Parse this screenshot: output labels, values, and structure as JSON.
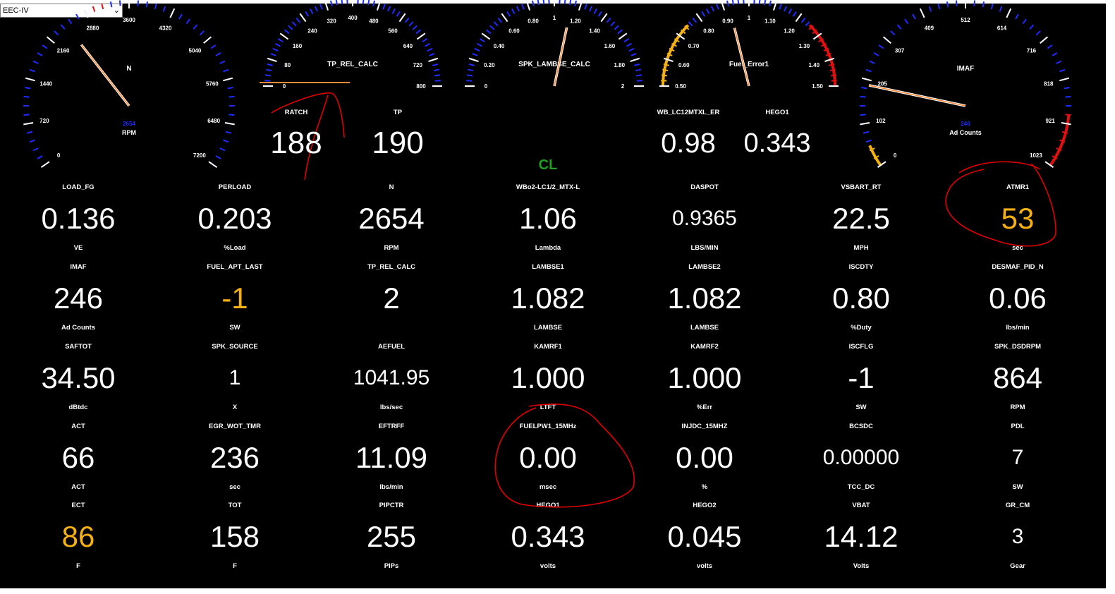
{
  "window": {
    "select_value": "EEC-IV"
  },
  "gauges": [
    {
      "id": "rpm",
      "title": "N",
      "unit": "RPM",
      "value": "2654",
      "ticks": [
        "0",
        "720",
        "1440",
        "2160",
        "2880",
        "3600",
        "4320",
        "5040",
        "5760",
        "6480",
        "7200"
      ]
    },
    {
      "id": "tp",
      "title": "TP_REL_CALC",
      "unit": "",
      "value": "",
      "ticks": [
        "0",
        "80",
        "160",
        "240",
        "320",
        "400",
        "480",
        "560",
        "640",
        "720",
        "800"
      ]
    },
    {
      "id": "spk",
      "title": "SPK_LAMBSE_CALC",
      "unit": "",
      "value": "",
      "ticks": [
        "0",
        "0.20",
        "0.40",
        "0.60",
        "0.80",
        "1",
        "1.20",
        "1.40",
        "1.60",
        "1.80",
        "2"
      ]
    },
    {
      "id": "fuel",
      "title": "Fuel_Error1",
      "unit": "",
      "value": "",
      "ticks": [
        "0.50",
        "0.60",
        "0.70",
        "0.80",
        "0.90",
        "1",
        "1.10",
        "1.20",
        "1.30",
        "1.40",
        "1.50"
      ]
    },
    {
      "id": "imaf",
      "title": "IMAF",
      "unit": "Ad Counts",
      "value": "246",
      "ticks": [
        "0",
        "102",
        "205",
        "307",
        "409",
        "512",
        "614",
        "716",
        "818",
        "921",
        "1023"
      ]
    }
  ],
  "top_readouts": [
    {
      "label": "RATCH",
      "value": "188"
    },
    {
      "label": "TP",
      "value": "190"
    },
    {
      "label": "WB_LC12MTXL_ER",
      "value": "0.98"
    },
    {
      "label": "HEGO1",
      "value": "0.343"
    }
  ],
  "status": {
    "loop_mode": "CL"
  },
  "grid": [
    [
      {
        "label": "LOAD_FG",
        "value": "0.136",
        "unit": "VE"
      },
      {
        "label": "PERLOAD",
        "value": "0.203",
        "unit": "%Load"
      },
      {
        "label": "N",
        "value": "2654",
        "unit": "RPM"
      },
      {
        "label": "WBo2-LC1/2_MTX-L",
        "value": "1.06",
        "unit": "Lambda"
      },
      {
        "label": "DASPOT",
        "value": "0.9365",
        "unit": "LBS/MIN",
        "small": true
      },
      {
        "label": "VSBART_RT",
        "value": "22.5",
        "unit": "MPH"
      },
      {
        "label": "ATMR1",
        "value": "53",
        "unit": "sec",
        "warn": true
      }
    ],
    [
      {
        "label": "IMAF",
        "value": "246",
        "unit": "Ad Counts"
      },
      {
        "label": "FUEL_APT_LAST",
        "value": "-1",
        "unit": "SW",
        "warn": true
      },
      {
        "label": "TP_REL_CALC",
        "value": "2",
        "unit": ""
      },
      {
        "label": "LAMBSE1",
        "value": "1.082",
        "unit": "LAMBSE"
      },
      {
        "label": "LAMBSE2",
        "value": "1.082",
        "unit": "LAMBSE"
      },
      {
        "label": "ISCDTY",
        "value": "0.80",
        "unit": "%Duty"
      },
      {
        "label": "DESMAF_PID_N",
        "value": "0.06",
        "unit": "lbs/min"
      }
    ],
    [
      {
        "label": "SAFTOT",
        "value": "34.50",
        "unit": "dBtdc"
      },
      {
        "label": "SPK_SOURCE",
        "value": "1",
        "unit": "X",
        "small": true
      },
      {
        "label": "AEFUEL",
        "value": "1041.95",
        "unit": "lbs/sec",
        "small": true
      },
      {
        "label": "KAMRF1",
        "value": "1.000",
        "unit": "LTFT"
      },
      {
        "label": "KAMRF2",
        "value": "1.000",
        "unit": "%Err"
      },
      {
        "label": "ISCFLG",
        "value": "-1",
        "unit": "SW"
      },
      {
        "label": "SPK_DSDRPM",
        "value": "864",
        "unit": "RPM"
      }
    ],
    [
      {
        "label": "ACT",
        "value": "66",
        "unit": "ACT"
      },
      {
        "label": "EGR_WOT_TMR",
        "value": "236",
        "unit": "sec"
      },
      {
        "label": "EFTRFF",
        "value": "11.09",
        "unit": "lbs/min"
      },
      {
        "label": "FUELPW1_15MHz",
        "value": "0.00",
        "unit": "msec"
      },
      {
        "label": "INJDC_15MHZ",
        "value": "0.00",
        "unit": "%"
      },
      {
        "label": "BCSDC",
        "value": "0.00000",
        "unit": "TCC_DC",
        "small": true
      },
      {
        "label": "PDL",
        "value": "7",
        "unit": "SW",
        "small": true
      }
    ],
    [
      {
        "label": "ECT",
        "value": "86",
        "unit": "F",
        "warn": true
      },
      {
        "label": "TOT",
        "value": "158",
        "unit": "F"
      },
      {
        "label": "PIPCTR",
        "value": "255",
        "unit": "PIPs"
      },
      {
        "label": "HEGO1",
        "value": "0.343",
        "unit": "volts"
      },
      {
        "label": "HEGO2",
        "value": "0.045",
        "unit": "volts"
      },
      {
        "label": "VBAT",
        "value": "14.12",
        "unit": "Volts"
      },
      {
        "label": "GR_CM",
        "value": "3",
        "unit": "Gear",
        "small": true
      }
    ]
  ],
  "colors": {
    "accent_blue": "#1e2cff",
    "warn": "#f5b014",
    "redline": "#e01010",
    "needle": "#ff8a3a",
    "status_green": "#1fa01f",
    "annotation": "#e00000"
  }
}
